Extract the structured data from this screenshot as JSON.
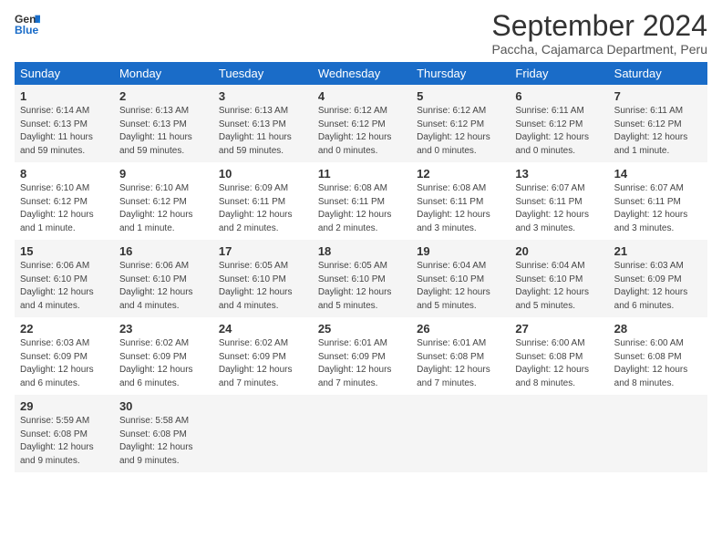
{
  "logo": {
    "line1": "General",
    "line2": "Blue"
  },
  "title": "September 2024",
  "subtitle": "Paccha, Cajamarca Department, Peru",
  "days_header": [
    "Sunday",
    "Monday",
    "Tuesday",
    "Wednesday",
    "Thursday",
    "Friday",
    "Saturday"
  ],
  "weeks": [
    [
      {
        "day": "1",
        "sunrise": "6:14 AM",
        "sunset": "6:13 PM",
        "daylight": "11 hours and 59 minutes."
      },
      {
        "day": "2",
        "sunrise": "6:13 AM",
        "sunset": "6:13 PM",
        "daylight": "11 hours and 59 minutes."
      },
      {
        "day": "3",
        "sunrise": "6:13 AM",
        "sunset": "6:13 PM",
        "daylight": "11 hours and 59 minutes."
      },
      {
        "day": "4",
        "sunrise": "6:12 AM",
        "sunset": "6:12 PM",
        "daylight": "12 hours and 0 minutes."
      },
      {
        "day": "5",
        "sunrise": "6:12 AM",
        "sunset": "6:12 PM",
        "daylight": "12 hours and 0 minutes."
      },
      {
        "day": "6",
        "sunrise": "6:11 AM",
        "sunset": "6:12 PM",
        "daylight": "12 hours and 0 minutes."
      },
      {
        "day": "7",
        "sunrise": "6:11 AM",
        "sunset": "6:12 PM",
        "daylight": "12 hours and 1 minute."
      }
    ],
    [
      {
        "day": "8",
        "sunrise": "6:10 AM",
        "sunset": "6:12 PM",
        "daylight": "12 hours and 1 minute."
      },
      {
        "day": "9",
        "sunrise": "6:10 AM",
        "sunset": "6:12 PM",
        "daylight": "12 hours and 1 minute."
      },
      {
        "day": "10",
        "sunrise": "6:09 AM",
        "sunset": "6:11 PM",
        "daylight": "12 hours and 2 minutes."
      },
      {
        "day": "11",
        "sunrise": "6:08 AM",
        "sunset": "6:11 PM",
        "daylight": "12 hours and 2 minutes."
      },
      {
        "day": "12",
        "sunrise": "6:08 AM",
        "sunset": "6:11 PM",
        "daylight": "12 hours and 3 minutes."
      },
      {
        "day": "13",
        "sunrise": "6:07 AM",
        "sunset": "6:11 PM",
        "daylight": "12 hours and 3 minutes."
      },
      {
        "day": "14",
        "sunrise": "6:07 AM",
        "sunset": "6:11 PM",
        "daylight": "12 hours and 3 minutes."
      }
    ],
    [
      {
        "day": "15",
        "sunrise": "6:06 AM",
        "sunset": "6:10 PM",
        "daylight": "12 hours and 4 minutes."
      },
      {
        "day": "16",
        "sunrise": "6:06 AM",
        "sunset": "6:10 PM",
        "daylight": "12 hours and 4 minutes."
      },
      {
        "day": "17",
        "sunrise": "6:05 AM",
        "sunset": "6:10 PM",
        "daylight": "12 hours and 4 minutes."
      },
      {
        "day": "18",
        "sunrise": "6:05 AM",
        "sunset": "6:10 PM",
        "daylight": "12 hours and 5 minutes."
      },
      {
        "day": "19",
        "sunrise": "6:04 AM",
        "sunset": "6:10 PM",
        "daylight": "12 hours and 5 minutes."
      },
      {
        "day": "20",
        "sunrise": "6:04 AM",
        "sunset": "6:10 PM",
        "daylight": "12 hours and 5 minutes."
      },
      {
        "day": "21",
        "sunrise": "6:03 AM",
        "sunset": "6:09 PM",
        "daylight": "12 hours and 6 minutes."
      }
    ],
    [
      {
        "day": "22",
        "sunrise": "6:03 AM",
        "sunset": "6:09 PM",
        "daylight": "12 hours and 6 minutes."
      },
      {
        "day": "23",
        "sunrise": "6:02 AM",
        "sunset": "6:09 PM",
        "daylight": "12 hours and 6 minutes."
      },
      {
        "day": "24",
        "sunrise": "6:02 AM",
        "sunset": "6:09 PM",
        "daylight": "12 hours and 7 minutes."
      },
      {
        "day": "25",
        "sunrise": "6:01 AM",
        "sunset": "6:09 PM",
        "daylight": "12 hours and 7 minutes."
      },
      {
        "day": "26",
        "sunrise": "6:01 AM",
        "sunset": "6:08 PM",
        "daylight": "12 hours and 7 minutes."
      },
      {
        "day": "27",
        "sunrise": "6:00 AM",
        "sunset": "6:08 PM",
        "daylight": "12 hours and 8 minutes."
      },
      {
        "day": "28",
        "sunrise": "6:00 AM",
        "sunset": "6:08 PM",
        "daylight": "12 hours and 8 minutes."
      }
    ],
    [
      {
        "day": "29",
        "sunrise": "5:59 AM",
        "sunset": "6:08 PM",
        "daylight": "12 hours and 9 minutes."
      },
      {
        "day": "30",
        "sunrise": "5:58 AM",
        "sunset": "6:08 PM",
        "daylight": "12 hours and 9 minutes."
      },
      null,
      null,
      null,
      null,
      null
    ]
  ]
}
